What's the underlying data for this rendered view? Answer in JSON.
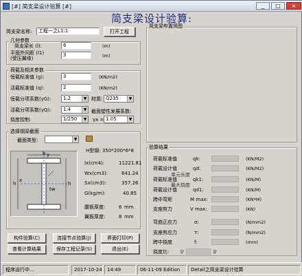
{
  "window": {
    "title": "[#] 简支梁设计验算 [#]",
    "min_glyph": "_",
    "max_glyph": "□",
    "close_glyph": "×"
  },
  "heading": "简支梁设计验算:",
  "beam_name": {
    "label": "简支梁名称:",
    "value": "工程一之L1:1",
    "open_button": "打开工程"
  },
  "geometry": {
    "title": "几何参数",
    "length_label": "简支梁长 (l):",
    "length_value": "6",
    "length_unit": "(m)",
    "brace_label": "平面外间距 (l1)",
    "brace_sub": "(受压翼缘)",
    "brace_value": "3",
    "brace_unit": "(m)"
  },
  "loads": {
    "title": "荷载及相关参数",
    "dead_label": "恒载标准值 (g):",
    "dead_value": "3",
    "dead_unit": "(KN/m2)",
    "live_label": "活载标准值 (q):",
    "live_value": "2",
    "live_unit": "(KN/m2)",
    "gamma_g_label": "恒载分项系数(γG):",
    "gamma_g_value": "1.2",
    "material_label": "材质:",
    "material_value": "Q235",
    "gamma_q_label": "活载分项系数(γQ):",
    "gamma_q_value": "1.4",
    "plastic_label": "截面塑性发展系数:",
    "deflection_label": "挠度控制:",
    "deflection_value": "1/250",
    "gamma_x_label": "γx =",
    "gamma_x_value": "1.05"
  },
  "section": {
    "title": "选择钢梁截面",
    "type_label": "截面类型:",
    "type_value": "",
    "model_label": "H型钢: 350*200*6*8",
    "props": [
      {
        "label": "Ix(cm4):",
        "value": "11221.81"
      },
      {
        "label": "Wx(cm3):",
        "value": "641.24"
      },
      {
        "label": "Sx(cm3):",
        "value": "357.26"
      },
      {
        "label": "G(kg/m):",
        "value": "40.85"
      }
    ],
    "web_label": "腹板厚度:",
    "web_value": "6",
    "web_unit": "mm",
    "flange_label": "翼板厚度:",
    "flange_value": "8",
    "flange_unit": "mm",
    "dim_b": "b",
    "dim_h": "h",
    "dim_tw": "tw",
    "dim_y": "y",
    "dim_x": "x"
  },
  "layout_panel": {
    "title": "简支梁布置简图"
  },
  "results": {
    "title": "验算结果",
    "rows": [
      {
        "label": "荷载标准值",
        "symbol": "qk:",
        "unit": "(KN/M2)"
      },
      {
        "label": "荷载设计值",
        "symbol": "qd:",
        "unit": "(KN/M2)"
      },
      {
        "label": "荷载标准值",
        "symbol": "qk1:",
        "unit": "(KN/M)"
      },
      {
        "label": "荷载设计值",
        "symbol": "qd1:",
        "unit": "(KN/M)"
      },
      {
        "label": "跨中弯矩",
        "symbol": "M max:",
        "unit": "(KN*M)"
      },
      {
        "label": "支座剪力",
        "symbol": "V max:",
        "unit": "(KN)"
      },
      {
        "label": "弯曲正应力",
        "symbol": "σ:",
        "unit": "(N/mm2)"
      },
      {
        "label": "支座剪应力",
        "symbol": "τ:",
        "unit": "(N/mm2)"
      },
      {
        "label": "跨中挠度",
        "symbol": "f:",
        "unit": "(mm)"
      }
    ],
    "overlap_a": "单元长度",
    "overlap_b": "最大挠度",
    "span_label": "挠度比:",
    "span_prefix": "l/",
    "span_mid": "l/"
  },
  "buttons": {
    "member_check": "构件验算(C)",
    "node_check": "连接节点验算(J)",
    "print": "界面打印(P)",
    "view_calc": "查看计算结果",
    "save": "保存工程记录(S)",
    "exit": "退出(E)"
  },
  "status": {
    "running": "程序运行中...",
    "date": "2017-10-24",
    "time": "14:49",
    "edition": "06-11-09 Edition",
    "module": "Detail之简支梁设计验算"
  }
}
